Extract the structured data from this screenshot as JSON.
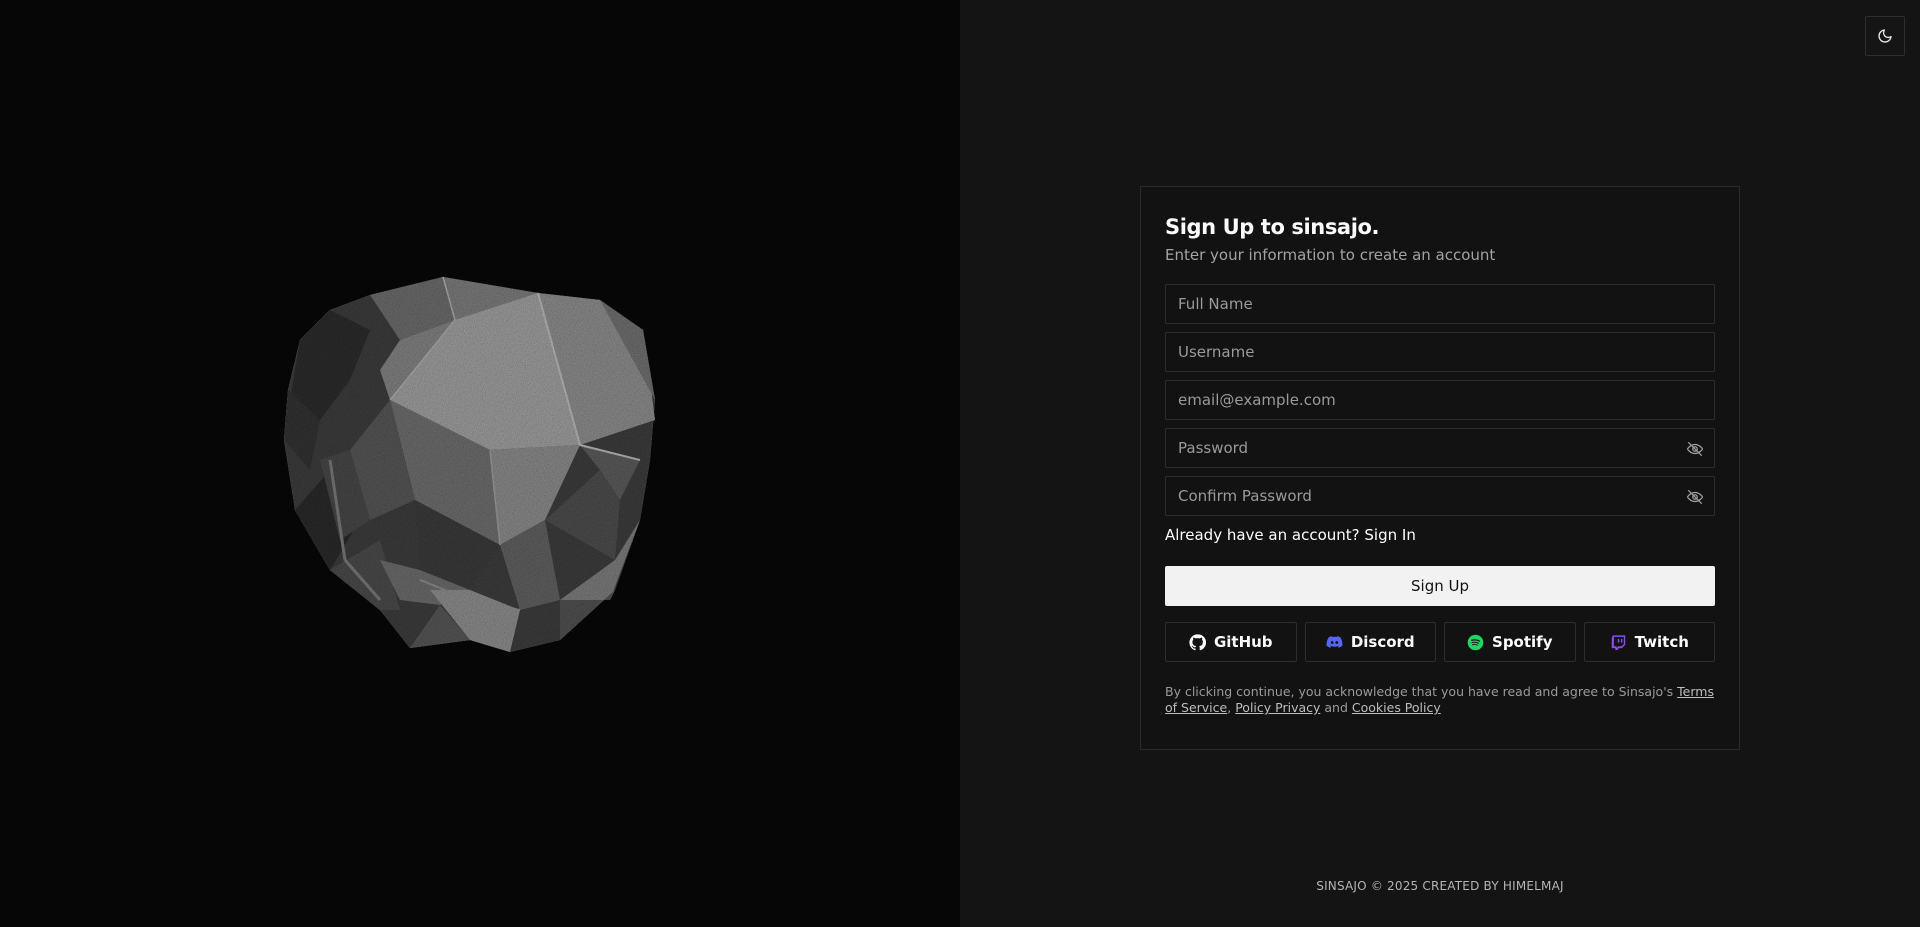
{
  "theme_toggle": {
    "icon": "moon-icon"
  },
  "card": {
    "title": "Sign Up to sinsajo.",
    "subtitle": "Enter your information to create an account"
  },
  "fields": {
    "full_name": {
      "placeholder": "Full Name",
      "value": ""
    },
    "username": {
      "placeholder": "Username",
      "value": ""
    },
    "email": {
      "placeholder": "email@example.com",
      "value": ""
    },
    "password": {
      "placeholder": "Password",
      "value": "",
      "icon": "eye-off-icon"
    },
    "confirm_password": {
      "placeholder": "Confirm Password",
      "value": "",
      "icon": "eye-off-icon"
    }
  },
  "signin": {
    "prompt": "Already have an account?",
    "link": "Sign In"
  },
  "signup_button": "Sign Up",
  "socials": [
    {
      "label": "GitHub",
      "icon": "github-icon",
      "color": "#ffffff"
    },
    {
      "label": "Discord",
      "icon": "discord-icon",
      "color": "#5865f2"
    },
    {
      "label": "Spotify",
      "icon": "spotify-icon",
      "color": "#1ed760"
    },
    {
      "label": "Twitch",
      "icon": "twitch-icon",
      "color": "#9146ff"
    }
  ],
  "legal": {
    "prefix": "By clicking continue, you acknowledge that you have read and agree to Sinsajo's",
    "terms": "Terms of Service",
    "sep1": ",",
    "privacy": "Policy Privacy",
    "and": "and",
    "cookies": "Cookies Policy"
  },
  "footer": "SINSAJO © 2025 CREATED BY HIMELMAJ",
  "colors": {
    "left_bg": "#060606",
    "right_bg": "#141414",
    "button_bg": "#f2f2f2",
    "border": "#2e2e2e"
  }
}
